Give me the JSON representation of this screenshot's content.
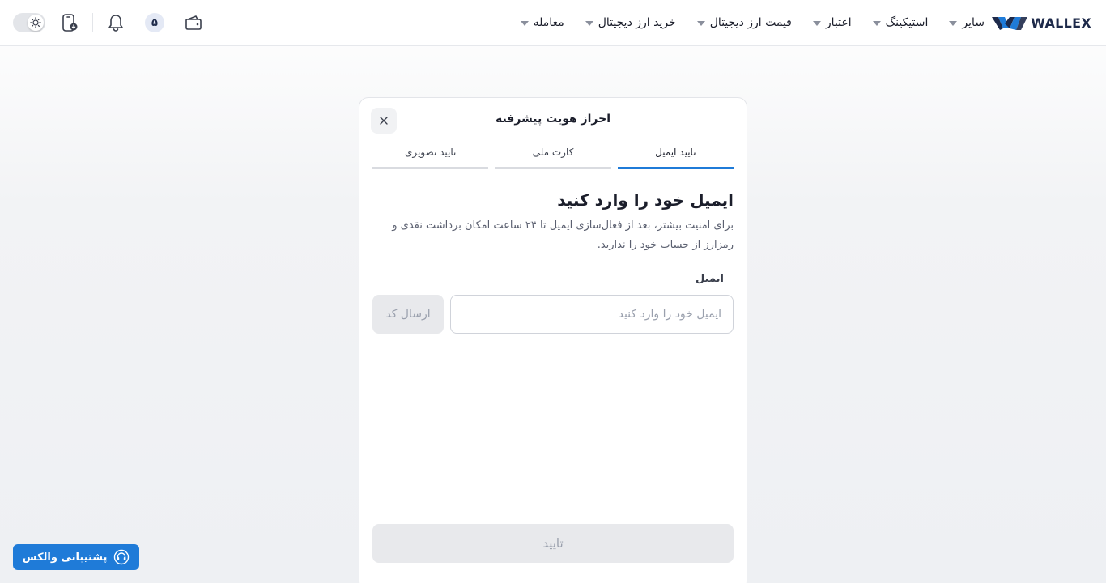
{
  "header": {
    "logo_text": "WALLEX",
    "nav": [
      {
        "label": "معامله"
      },
      {
        "label": "خرید ارز دیجیتال"
      },
      {
        "label": "قیمت ارز دیجیتال"
      },
      {
        "label": "اعتبار"
      },
      {
        "label": "استیکینگ"
      },
      {
        "label": "سایر"
      }
    ],
    "level_badge": "۵",
    "icons": [
      "wallet-icon",
      "level-badge",
      "bell-icon",
      "mobile-download-icon",
      "theme-toggle"
    ]
  },
  "modal": {
    "title": "احراز هویت پیشرفته",
    "tabs": [
      {
        "label": "تایید ایمیل",
        "active": true
      },
      {
        "label": "کارت ملی",
        "active": false
      },
      {
        "label": "تایید تصویری",
        "active": false
      }
    ],
    "heading": "ایمیل خود را وارد کنید",
    "description": "برای امنیت بیشتر، بعد از فعال‌سازی ایمیل تا ۲۴ ساعت امکان برداشت نقدی و رمزارز از حساب خود را ندارید.",
    "email_label": "ایمیل",
    "email_placeholder": "ایمیل خود را وارد کنید",
    "email_value": "",
    "send_code_label": "ارسال کد",
    "confirm_label": "تایید"
  },
  "support": {
    "label": "پشتیبانی والکس"
  },
  "colors": {
    "accent": "#1f7bd8",
    "brand_dark": "#1e2a4a",
    "disabled_bg": "#e8e9ec",
    "disabled_text": "#9aa0ad"
  }
}
